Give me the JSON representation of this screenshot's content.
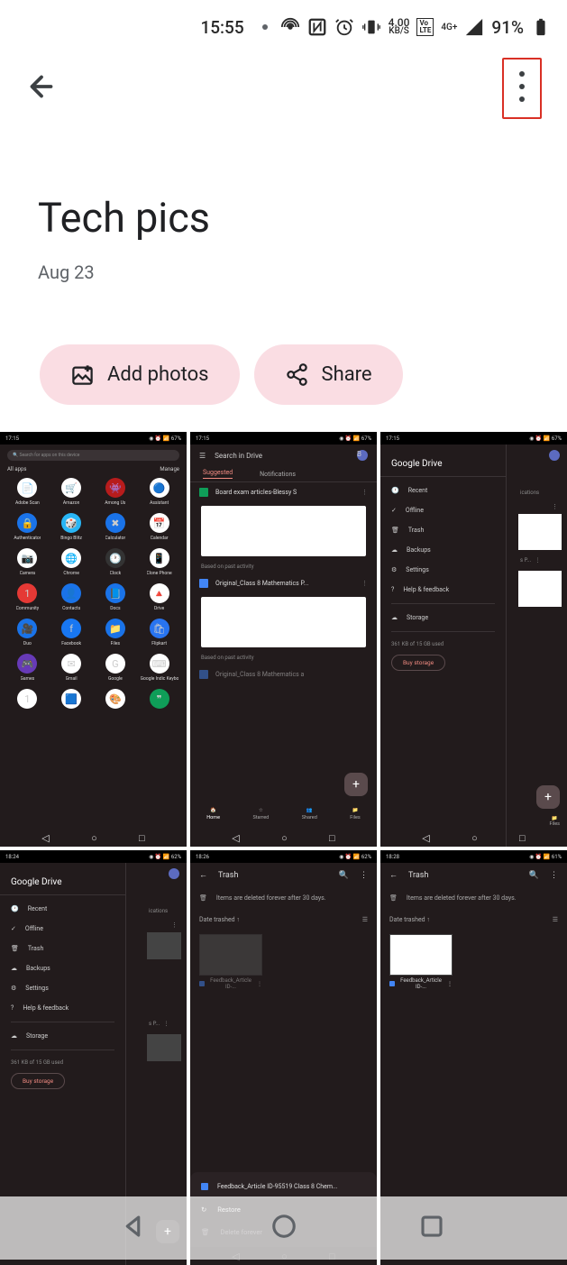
{
  "status_bar": {
    "time": "15:55",
    "net_speed": "4.00",
    "net_unit": "KB/S",
    "volte": "Vo\nLTE",
    "signal": "4G+",
    "battery_pct": "91%"
  },
  "app_bar": {},
  "album": {
    "title": "Tech pics",
    "date": "Aug 23"
  },
  "actions": {
    "add_photos": "Add photos",
    "share": "Share"
  },
  "thumbs": {
    "all_apps": {
      "status_time": "17:15",
      "status_batt": "67%",
      "search_placeholder": "Search for apps on this device",
      "all_apps_label": "All apps",
      "manage_label": "Manage",
      "apps": [
        {
          "name": "Adobe Scan",
          "bg": "#fff",
          "emoji": "📄"
        },
        {
          "name": "Amazon",
          "bg": "#fff",
          "emoji": "🛒"
        },
        {
          "name": "Among Us",
          "bg": "#b71c1c",
          "emoji": "👾"
        },
        {
          "name": "Assistant",
          "bg": "#fff",
          "emoji": "🔵"
        },
        {
          "name": "Authenticator",
          "bg": "#1a73e8",
          "emoji": "🔒"
        },
        {
          "name": "Bingo Blitz",
          "bg": "#29b6f6",
          "emoji": "🎲"
        },
        {
          "name": "Calculator",
          "bg": "#1a73e8",
          "emoji": "✖"
        },
        {
          "name": "Calendar",
          "bg": "#fff",
          "emoji": "📅"
        },
        {
          "name": "Camera",
          "bg": "#fff",
          "emoji": "📷"
        },
        {
          "name": "Chrome",
          "bg": "#fff",
          "emoji": "🌐"
        },
        {
          "name": "Clock",
          "bg": "#333",
          "emoji": "🕐"
        },
        {
          "name": "Clone Phone",
          "bg": "#fff",
          "emoji": "📱"
        },
        {
          "name": "Community",
          "bg": "#e53935",
          "emoji": "1"
        },
        {
          "name": "Contacts",
          "bg": "#1a73e8",
          "emoji": "👤"
        },
        {
          "name": "Docs",
          "bg": "#1a73e8",
          "emoji": "📘"
        },
        {
          "name": "Drive",
          "bg": "#fff",
          "emoji": "🔺"
        },
        {
          "name": "Duo",
          "bg": "#1a73e8",
          "emoji": "🎥"
        },
        {
          "name": "Facebook",
          "bg": "#1877f2",
          "emoji": "f"
        },
        {
          "name": "Files",
          "bg": "#1a73e8",
          "emoji": "📁"
        },
        {
          "name": "Flipkart",
          "bg": "#2874f0",
          "emoji": "🛍"
        },
        {
          "name": "Games",
          "bg": "#673ab7",
          "emoji": "🎮"
        },
        {
          "name": "Gmail",
          "bg": "#fff",
          "emoji": "✉"
        },
        {
          "name": "Google",
          "bg": "#fff",
          "emoji": "G"
        },
        {
          "name": "Google Indic Keyboard",
          "bg": "#fff",
          "emoji": "⌨"
        },
        {
          "name": "",
          "bg": "#fff",
          "emoji": "1"
        },
        {
          "name": "",
          "bg": "#fff",
          "emoji": "🟦"
        },
        {
          "name": "",
          "bg": "#fff",
          "emoji": "🎨"
        },
        {
          "name": "",
          "bg": "#0f9d58",
          "emoji": "❞"
        }
      ]
    },
    "drive_main": {
      "status_time": "17:15",
      "status_batt": "67%",
      "search_label": "Search in Drive",
      "tab_suggested": "Suggested",
      "tab_notifications": "Notifications",
      "file1": "Board exam articles-Blessy S",
      "file2": "Original_Class 8 Mathematics P...",
      "file3": "Original_Class 8 Mathematics a",
      "based_on": "Based on past activity",
      "nav": {
        "home": "Home",
        "starred": "Starred",
        "shared": "Shared",
        "files": "Files"
      }
    },
    "drive_menu": {
      "status_time": "17:15",
      "status_batt": "67%",
      "logo": "Google Drive",
      "items": [
        {
          "icon": "recent",
          "label": "Recent"
        },
        {
          "icon": "offline",
          "label": "Offline"
        },
        {
          "icon": "trash",
          "label": "Trash"
        },
        {
          "icon": "backups",
          "label": "Backups"
        },
        {
          "icon": "settings",
          "label": "Settings"
        },
        {
          "icon": "help",
          "label": "Help & feedback"
        },
        {
          "icon": "storage",
          "label": "Storage"
        }
      ],
      "storage_text": "361 KB of 15 GB used",
      "buy_storage": "Buy storage"
    },
    "drive_menu2": {
      "status_time": "18:24",
      "status_batt": "62%"
    },
    "trash1": {
      "status_time": "18:26",
      "status_batt": "62%",
      "title": "Trash",
      "banner": "Items are deleted forever after 30 days.",
      "sort": "Date trashed",
      "file_caption": "Feedback_Article ID-...",
      "sheet_title": "Feedback_Article ID-95519 Class 8 Chem...",
      "restore": "Restore",
      "delete_forever": "Delete forever"
    },
    "trash2": {
      "status_time": "18:28",
      "status_batt": "61%",
      "title": "Trash",
      "banner": "Items are deleted forever after 30 days.",
      "sort": "Date trashed",
      "file_caption": "Feedback_Article ID-..."
    }
  }
}
